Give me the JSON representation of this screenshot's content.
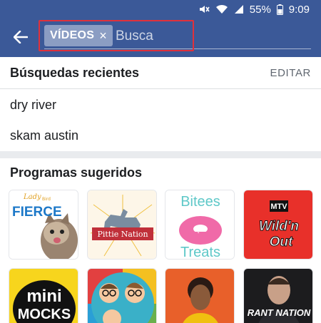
{
  "status_bar": {
    "battery": "55%",
    "time": "9:09",
    "icons": [
      "mute-icon",
      "wifi-icon",
      "signal-icon",
      "battery-icon"
    ]
  },
  "search": {
    "chip_label": "VÍDEOS",
    "chip_clear": "×",
    "placeholder": "Busca",
    "value": ""
  },
  "recent": {
    "title": "Búsquedas recientes",
    "edit_label": "EDITAR",
    "items": [
      "dry river",
      "skam austin"
    ]
  },
  "suggested": {
    "title": "Programas sugeridos",
    "thumb_texts": {
      "fierce_small": "Lady",
      "fierce_small2": "Bird",
      "fierce": "FIERCE",
      "pittie": "Pittie Nation",
      "bitees": "Bitees",
      "treats": "Treats",
      "mtv": "MTV",
      "wild_n": "Wild'n",
      "wild_out": "Out",
      "mini": "mini",
      "mocks": "MOCKS",
      "rant": "RANT NATION"
    }
  },
  "colors": {
    "header": "#3b5998",
    "chip": "#8b9dc3",
    "highlight": "#e0313b"
  }
}
